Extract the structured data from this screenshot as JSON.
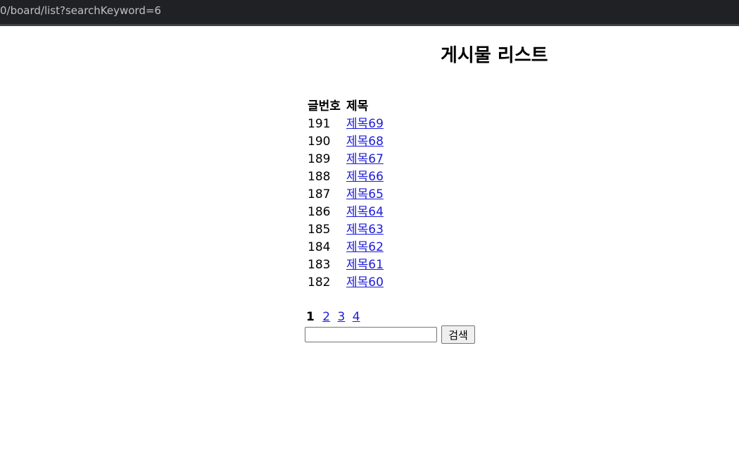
{
  "browser": {
    "url": "0/board/list?searchKeyword=6"
  },
  "page": {
    "title": "게시물 리스트",
    "table": {
      "headers": [
        "글번호",
        "제목"
      ],
      "rows": [
        {
          "num": "191",
          "title": "제목69"
        },
        {
          "num": "190",
          "title": "제목68"
        },
        {
          "num": "189",
          "title": "제목67"
        },
        {
          "num": "188",
          "title": "제목66"
        },
        {
          "num": "187",
          "title": "제목65"
        },
        {
          "num": "186",
          "title": "제목64"
        },
        {
          "num": "185",
          "title": "제목63"
        },
        {
          "num": "184",
          "title": "제목62"
        },
        {
          "num": "183",
          "title": "제목61"
        },
        {
          "num": "182",
          "title": "제목60"
        }
      ]
    },
    "pagination": {
      "current": "1",
      "pages": [
        "2",
        "3",
        "4"
      ]
    },
    "search": {
      "value": "",
      "button_label": "검색"
    }
  }
}
